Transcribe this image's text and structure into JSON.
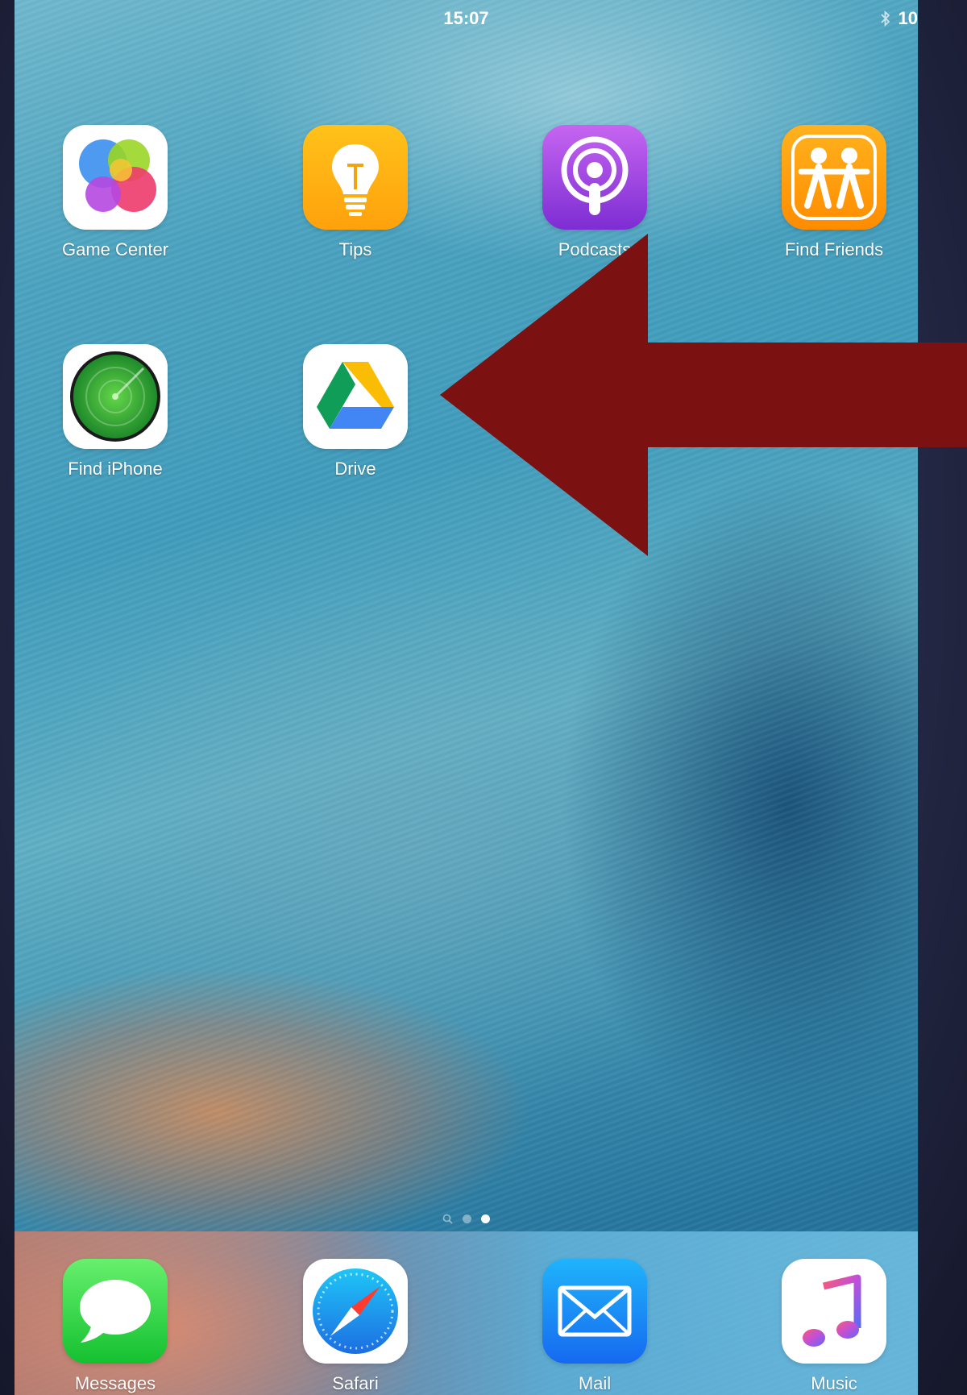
{
  "status_bar": {
    "time": "15:07",
    "battery_text": "10"
  },
  "home": {
    "apps": [
      {
        "name": "Game Center",
        "icon": "game-center-icon"
      },
      {
        "name": "Tips",
        "icon": "tips-icon"
      },
      {
        "name": "Podcasts",
        "icon": "podcasts-icon"
      },
      {
        "name": "Find Friends",
        "icon": "find-friends-icon"
      },
      {
        "name": "Find iPhone",
        "icon": "find-iphone-icon"
      },
      {
        "name": "Drive",
        "icon": "google-drive-icon"
      }
    ]
  },
  "page_indicator": {
    "pages": 3,
    "current_page": 3
  },
  "dock": {
    "apps": [
      {
        "name": "Messages",
        "icon": "messages-icon"
      },
      {
        "name": "Safari",
        "icon": "safari-icon"
      },
      {
        "name": "Mail",
        "icon": "mail-icon"
      },
      {
        "name": "Music",
        "icon": "music-icon"
      }
    ]
  },
  "annotation": {
    "arrow_color": "#7b1111",
    "points_to": "Drive"
  }
}
